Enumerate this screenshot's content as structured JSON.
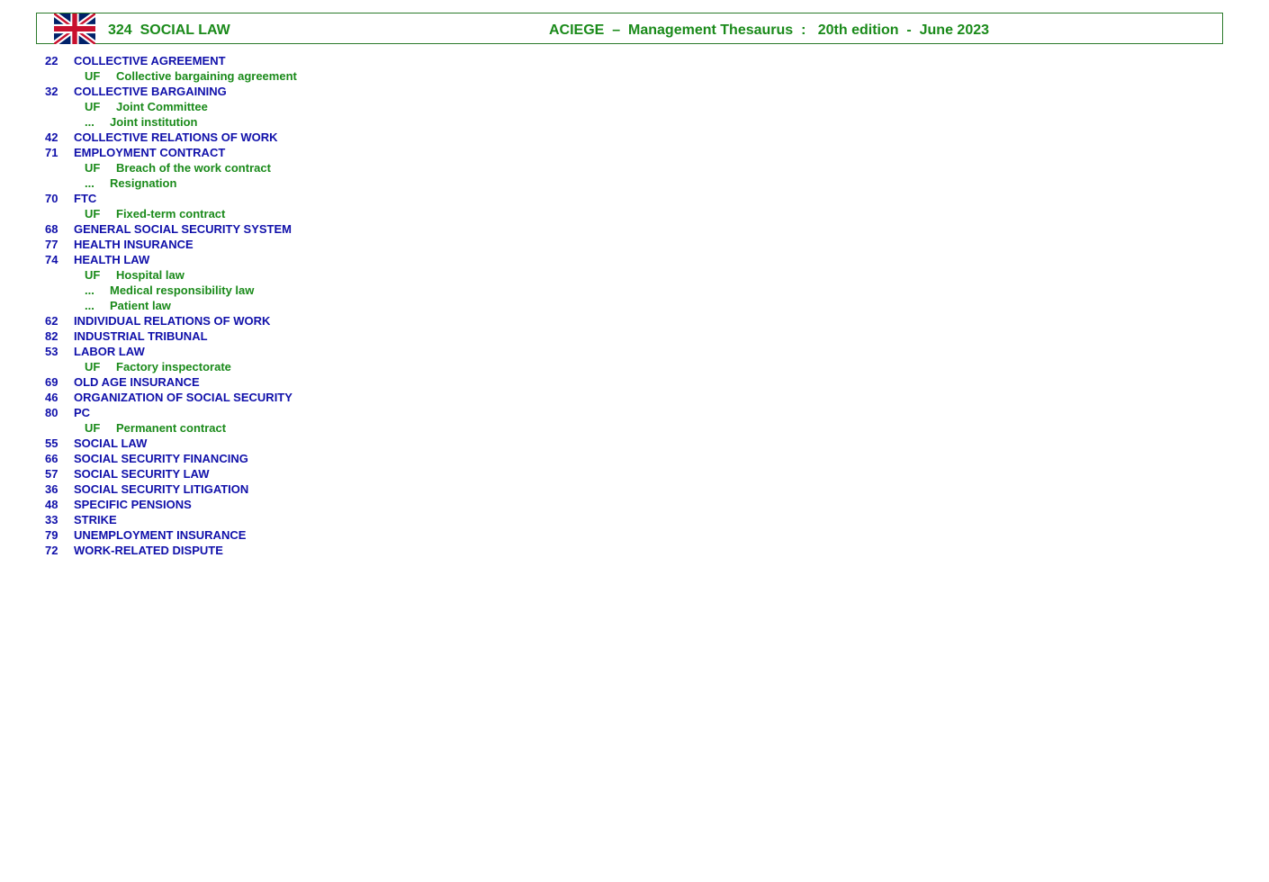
{
  "header": {
    "section": "324  SOCIAL LAW",
    "publication": "ACIEGE  –  Management Thesaurus  :   20th edition  -  June 2023",
    "flag_icon": "union-jack-flag-icon"
  },
  "colors": {
    "term": "#1010aa",
    "related": "#1a8a1a",
    "border": "#2b7a2b"
  },
  "entries": [
    {
      "type": "term",
      "num": "22",
      "text": "COLLECTIVE AGREEMENT"
    },
    {
      "type": "uf",
      "marker": "UF",
      "text": "Collective bargaining agreement"
    },
    {
      "type": "term",
      "num": "32",
      "text": "COLLECTIVE BARGAINING"
    },
    {
      "type": "uf",
      "marker": "UF",
      "text": "Joint Committee"
    },
    {
      "type": "rel",
      "marker": "...",
      "text": "Joint institution"
    },
    {
      "type": "term",
      "num": "42",
      "text": "COLLECTIVE RELATIONS OF WORK"
    },
    {
      "type": "term",
      "num": "71",
      "text": "EMPLOYMENT CONTRACT"
    },
    {
      "type": "uf",
      "marker": "UF",
      "text": "Breach of the work contract"
    },
    {
      "type": "rel",
      "marker": "...",
      "text": "Resignation"
    },
    {
      "type": "term",
      "num": "70",
      "text": "FTC"
    },
    {
      "type": "uf",
      "marker": "UF",
      "text": "Fixed-term contract"
    },
    {
      "type": "term",
      "num": "68",
      "text": "GENERAL SOCIAL SECURITY SYSTEM"
    },
    {
      "type": "term",
      "num": "77",
      "text": "HEALTH INSURANCE"
    },
    {
      "type": "term",
      "num": "74",
      "text": "HEALTH LAW"
    },
    {
      "type": "uf",
      "marker": "UF",
      "text": "Hospital law"
    },
    {
      "type": "rel",
      "marker": "...",
      "text": "Medical responsibility law"
    },
    {
      "type": "rel",
      "marker": "...",
      "text": "Patient law"
    },
    {
      "type": "term",
      "num": "62",
      "text": "INDIVIDUAL RELATIONS OF WORK"
    },
    {
      "type": "term",
      "num": "82",
      "text": "INDUSTRIAL TRIBUNAL"
    },
    {
      "type": "term",
      "num": "53",
      "text": "LABOR LAW"
    },
    {
      "type": "uf",
      "marker": "UF",
      "text": "Factory inspectorate"
    },
    {
      "type": "term",
      "num": "69",
      "text": "OLD AGE INSURANCE"
    },
    {
      "type": "term",
      "num": "46",
      "text": "ORGANIZATION OF SOCIAL SECURITY"
    },
    {
      "type": "term",
      "num": "80",
      "text": "PC"
    },
    {
      "type": "uf",
      "marker": "UF",
      "text": "Permanent contract"
    },
    {
      "type": "term",
      "num": "55",
      "text": "SOCIAL LAW"
    },
    {
      "type": "term",
      "num": "66",
      "text": "SOCIAL SECURITY FINANCING"
    },
    {
      "type": "term",
      "num": "57",
      "text": "SOCIAL SECURITY LAW"
    },
    {
      "type": "term",
      "num": "36",
      "text": "SOCIAL SECURITY LITIGATION"
    },
    {
      "type": "term",
      "num": "48",
      "text": "SPECIFIC PENSIONS"
    },
    {
      "type": "term",
      "num": "33",
      "text": "STRIKE"
    },
    {
      "type": "term",
      "num": "79",
      "text": "UNEMPLOYMENT INSURANCE"
    },
    {
      "type": "term",
      "num": "72",
      "text": "WORK-RELATED DISPUTE"
    }
  ]
}
